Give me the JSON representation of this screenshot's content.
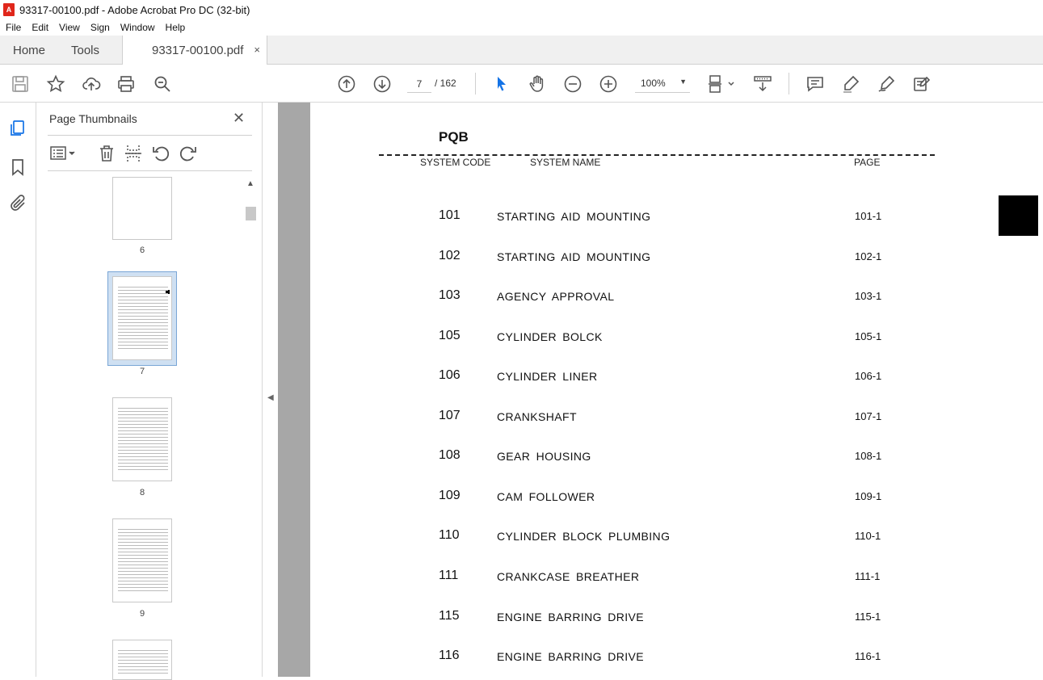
{
  "window": {
    "title": "93317-00100.pdf - Adobe Acrobat Pro DC (32-bit)",
    "app_icon": "pdf-icon"
  },
  "menu": [
    "File",
    "Edit",
    "View",
    "Sign",
    "Window",
    "Help"
  ],
  "tabs": {
    "home": "Home",
    "tools": "Tools",
    "document": "93317-00100.pdf",
    "close": "×"
  },
  "toolbar": {
    "current_page": "7",
    "total_pages": "/ 162",
    "zoom": "100%",
    "zoom_caret": "▼"
  },
  "thumbnails": {
    "title": "Page Thumbnails",
    "close": "✕",
    "pages": [
      "6",
      "7",
      "8",
      "9"
    ],
    "selected_page": "7"
  },
  "document": {
    "header": "PQB",
    "columns": {
      "code": "SYSTEM CODE",
      "name": "SYSTEM  NAME",
      "page": "PAGE"
    },
    "rows": [
      {
        "code": "101",
        "name": "STARTING AID MOUNTING",
        "page": "101-1"
      },
      {
        "code": "102",
        "name": "STARTING AID MOUNTING",
        "page": "102-1"
      },
      {
        "code": "103",
        "name": "AGENCY APPROVAL",
        "page": "103-1"
      },
      {
        "code": "105",
        "name": "CYLINDER BOLCK",
        "page": "105-1"
      },
      {
        "code": "106",
        "name": "CYLINDER LINER",
        "page": "106-1"
      },
      {
        "code": "107",
        "name": "CRANKSHAFT",
        "page": "107-1"
      },
      {
        "code": "108",
        "name": "GEAR HOUSING",
        "page": "108-1"
      },
      {
        "code": "109",
        "name": "CAM FOLLOWER",
        "page": "109-1"
      },
      {
        "code": "110",
        "name": "CYLINDER BLOCK PLUMBING",
        "page": "110-1"
      },
      {
        "code": "111",
        "name": "CRANKCASE BREATHER",
        "page": "111-1"
      },
      {
        "code": "115",
        "name": "ENGINE BARRING DRIVE",
        "page": "115-1"
      },
      {
        "code": "116",
        "name": "ENGINE BARRING DRIVE",
        "page": "116-1"
      }
    ]
  },
  "colors": {
    "select_arrow": "#1473e6",
    "gutter": "#a7a7a7",
    "thumb_selection": "#cfe0f2"
  }
}
